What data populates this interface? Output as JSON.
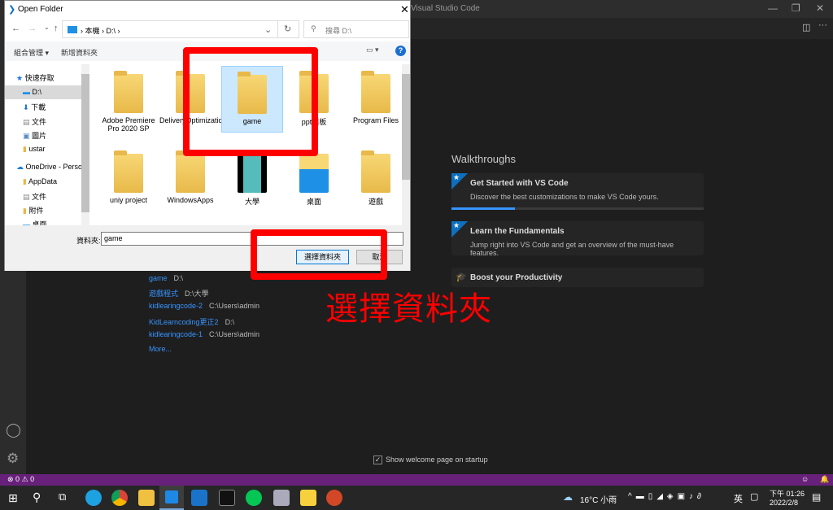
{
  "vscode": {
    "title": "Visual Studio Code",
    "status": {
      "errors": "0",
      "warnings": "0"
    },
    "recent": [
      {
        "name": "game",
        "path": "D:\\"
      },
      {
        "name": "遊戲程式",
        "path": "D:\\大學"
      },
      {
        "name": "kidlearingcode-2",
        "path": "C:\\Users\\admin"
      },
      {
        "name": "KidLearncoding更正2",
        "path": "D:\\"
      },
      {
        "name": "kidlearingcode-1",
        "path": "C:\\Users\\admin"
      }
    ],
    "more": "More...",
    "walkthroughs": {
      "heading": "Walkthroughs",
      "items": [
        {
          "title": "Get Started with VS Code",
          "desc": "Discover the best customizations to make VS Code yours.",
          "progress": 25
        },
        {
          "title": "Learn the Fundamentals",
          "desc": "Jump right into VS Code and get an overview of the must-have features."
        },
        {
          "title": "Boost your Productivity"
        }
      ]
    },
    "show_welcome": "Show welcome page on startup",
    "accent": "#0e70c0",
    "status_color": "#68217a"
  },
  "dialog": {
    "title": "Open Folder",
    "breadcrumb": [
      "本機",
      "D:\\"
    ],
    "search_placeholder": "搜尋 D:\\",
    "organize": "組合管理 ▾",
    "new_folder": "新增資料夾",
    "nav": [
      {
        "label": "快速存取"
      },
      {
        "label": "D:\\"
      },
      {
        "label": "下載"
      },
      {
        "label": "文件"
      },
      {
        "label": "圖片"
      },
      {
        "label": "ustar"
      },
      {
        "label": "OneDrive - Perso"
      },
      {
        "label": "AppData"
      },
      {
        "label": "文件"
      },
      {
        "label": "附件"
      },
      {
        "label": "桌面"
      }
    ],
    "files": [
      "Adobe Premiere Pro 2020 SP",
      "DeliveryOptimization",
      "game",
      "ppt模板",
      "Program Files",
      "uniy project",
      "WindowsApps",
      "大學",
      "桌面",
      "遊戲"
    ],
    "folder_label": "資料夾:",
    "folder_value": "game",
    "select_button": "選擇資料夾",
    "cancel_button": "取消"
  },
  "annotation": "選擇資料夾",
  "taskbar": {
    "weather": "16°C 小雨",
    "ime": "英",
    "time": "下午 01:26",
    "date": "2022/2/8"
  }
}
